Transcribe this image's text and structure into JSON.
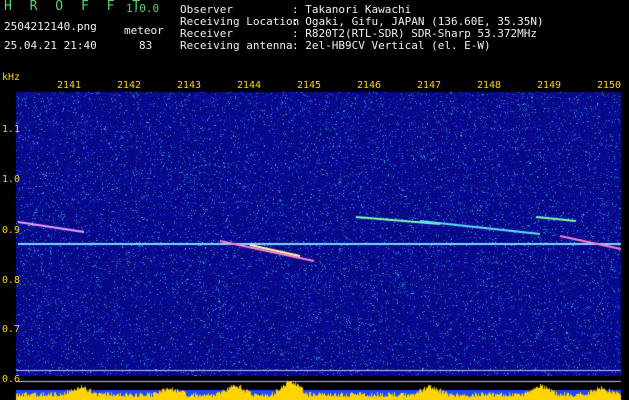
{
  "header": {
    "app_name": "H R O F F T",
    "version": "1.0.0",
    "filename": "2504212140.png",
    "type_label": "meteor",
    "timestamp": "25.04.21 21:40",
    "count": "83",
    "info_labels": [
      "Observer",
      "Receiving Location",
      "Receiver",
      "Receiving antenna"
    ],
    "info_values": [
      ": Takanori Kawachi",
      ": Ogaki, Gifu, JAPAN (136.60E, 35.35N)",
      ": R820T2(RTL-SDR) SDR-Sharp 53.372MHz",
      ": 2el-HB9CV Vertical (el. E-W)"
    ]
  },
  "axis": {
    "y_unit": "kHz",
    "y_ticks": [
      "1.1",
      "1.0",
      "0.9",
      "0.8",
      "0.7",
      "0.6"
    ],
    "x_ticks": [
      "2141",
      "2142",
      "2143",
      "2144",
      "2145",
      "2146",
      "2147",
      "2148",
      "2149",
      "2150"
    ]
  },
  "colors": {
    "background": "#000000",
    "header_text": "#55d66a",
    "axis_text": "#ffd400",
    "spectrogram_base": "#0a0a8c",
    "carrier_line": "#7fd7ff",
    "meteor_trail": "#ff7fd0",
    "level_bars": "#ffd400"
  }
}
